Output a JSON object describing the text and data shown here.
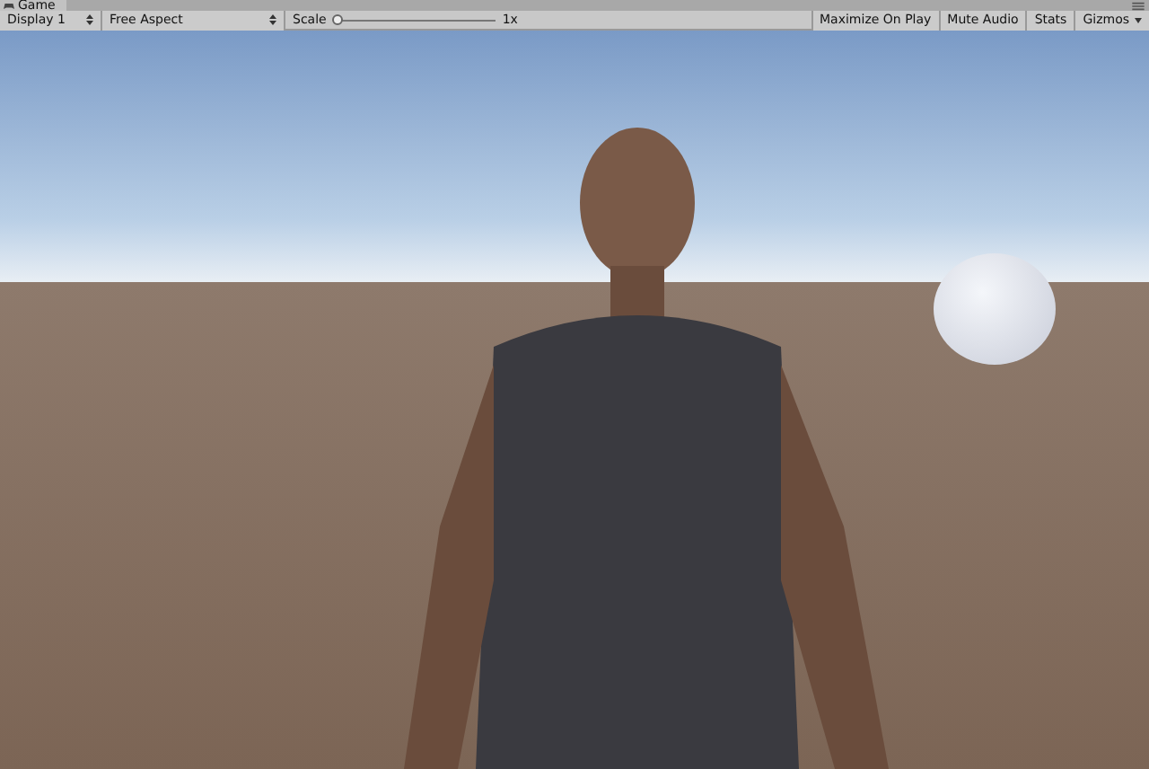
{
  "window": {
    "tab": "Game"
  },
  "toolbar": {
    "display": "Display 1",
    "aspect": "Free Aspect",
    "scale": {
      "label": "Scale",
      "level": 0,
      "reading": "1x"
    },
    "toggles": [
      {
        "label": "Maximize On Play",
        "on": false
      },
      {
        "label": "Mute Audio",
        "on": false
      },
      {
        "label": "Stats",
        "on": false
      }
    ],
    "gizmos": "Gizmos"
  }
}
